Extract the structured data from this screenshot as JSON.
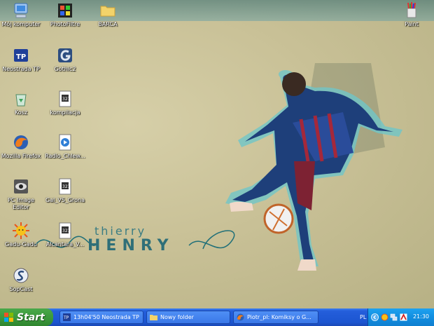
{
  "desktop": {
    "icons": [
      {
        "label": "Mój komputer"
      },
      {
        "label": "PhotoFiltre"
      },
      {
        "label": "BARCA"
      },
      {
        "label": "Paint"
      },
      {
        "label": "Neostrada TP"
      },
      {
        "label": "Gothic2"
      },
      {
        "label": "Kosz"
      },
      {
        "label": "kompilacja"
      },
      {
        "label": "Mozilla Firefox"
      },
      {
        "label": "Radio_Chlew..."
      },
      {
        "label": "PC Image Editor"
      },
      {
        "label": "Gal_VS_Grona"
      },
      {
        "label": "Gadu-Gadu"
      },
      {
        "label": "Alcantara_V..."
      },
      {
        "label": "SopCast"
      }
    ],
    "wallpaper": {
      "first_name": "thierry",
      "last_name": "HENRY"
    }
  },
  "taskbar": {
    "start_label": "Start",
    "tasks": [
      {
        "label": "13h04'50 Neostrada TP"
      },
      {
        "label": "Nowy folder"
      },
      {
        "label": "Piotr_pl: Komiksy o G..."
      }
    ],
    "language": "PL",
    "clock": "21:30"
  },
  "colors": {
    "taskbar": "#245edb",
    "start": "#3c9a3c",
    "tray": "#128ee0"
  }
}
